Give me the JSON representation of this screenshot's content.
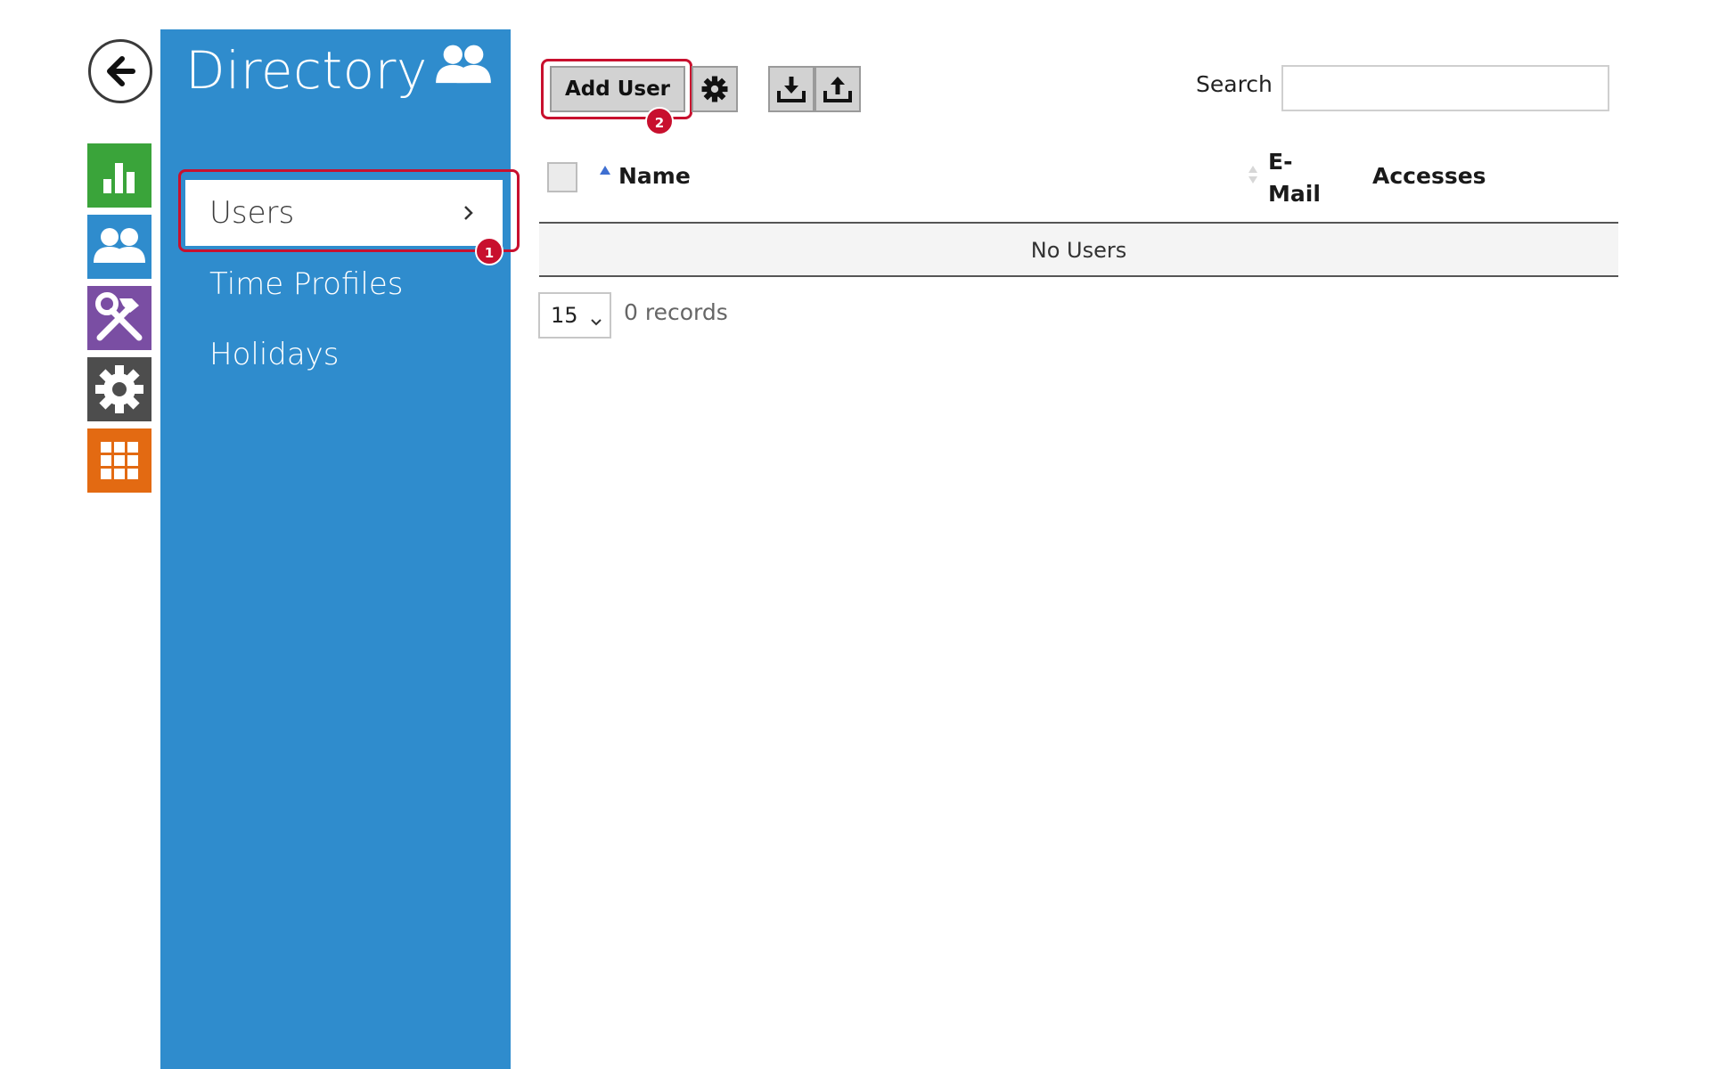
{
  "sidebar": {
    "back_icon": "arrow-left-icon",
    "modules": [
      {
        "name": "status",
        "icon": "bar-chart-icon",
        "color": "#3aa43a"
      },
      {
        "name": "directory",
        "icon": "users-icon",
        "color": "#2f8ccd"
      },
      {
        "name": "hardware",
        "icon": "tools-icon",
        "color": "#7a4ea3"
      },
      {
        "name": "system",
        "icon": "gear-icon",
        "color": "#4d4d4d"
      },
      {
        "name": "services",
        "icon": "grid-icon",
        "color": "#e36a12"
      }
    ]
  },
  "panel": {
    "title": "Directory",
    "title_icon": "users-icon",
    "color": "#2f8ccd",
    "nav": [
      {
        "label": "Users",
        "active": true
      },
      {
        "label": "Time Profiles",
        "active": false
      },
      {
        "label": "Holidays",
        "active": false
      }
    ]
  },
  "annotations": {
    "step1": "1",
    "step2": "2",
    "color": "#c8102e"
  },
  "toolbar": {
    "add_user_label": "Add User",
    "settings_icon": "gear-icon",
    "download_icon": "download-icon",
    "upload_icon": "upload-icon",
    "search_label": "Search",
    "search_value": ""
  },
  "table": {
    "columns": [
      {
        "label": "Name",
        "sort": "ascending"
      },
      {
        "label": "E-\nMail",
        "sort": "none"
      },
      {
        "label": "Accesses",
        "sort": "none"
      }
    ],
    "empty_message": "No Users",
    "rows": []
  },
  "pagination": {
    "page_size": "15",
    "records_text": "0 records"
  }
}
